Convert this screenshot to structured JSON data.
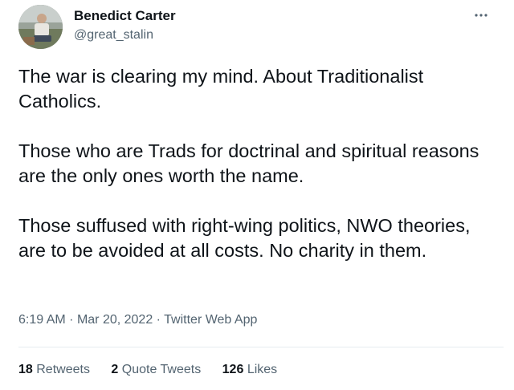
{
  "author": {
    "name": "Benedict Carter",
    "handle": "@great_stalin"
  },
  "tweet": {
    "paragraphs": [
      "The war is clearing my mind. About Traditionalist Catholics.",
      "Those who are Trads for doctrinal and spiritual reasons are the only ones worth the name.",
      "Those suffused with right-wing politics, NWO theories, are to be avoided at all costs. No charity in them."
    ]
  },
  "meta": {
    "time": "6:19 AM",
    "date": "Mar 20, 2022",
    "separator": "·",
    "source": "Twitter Web App"
  },
  "stats": {
    "retweets_count": "18",
    "retweets_label": "Retweets",
    "quotes_count": "2",
    "quotes_label": "Quote Tweets",
    "likes_count": "126",
    "likes_label": "Likes"
  },
  "icons": {
    "more": "more-options-icon"
  },
  "colors": {
    "text": "#0f1419",
    "secondary": "#536471",
    "divider": "#e6ecf0"
  }
}
